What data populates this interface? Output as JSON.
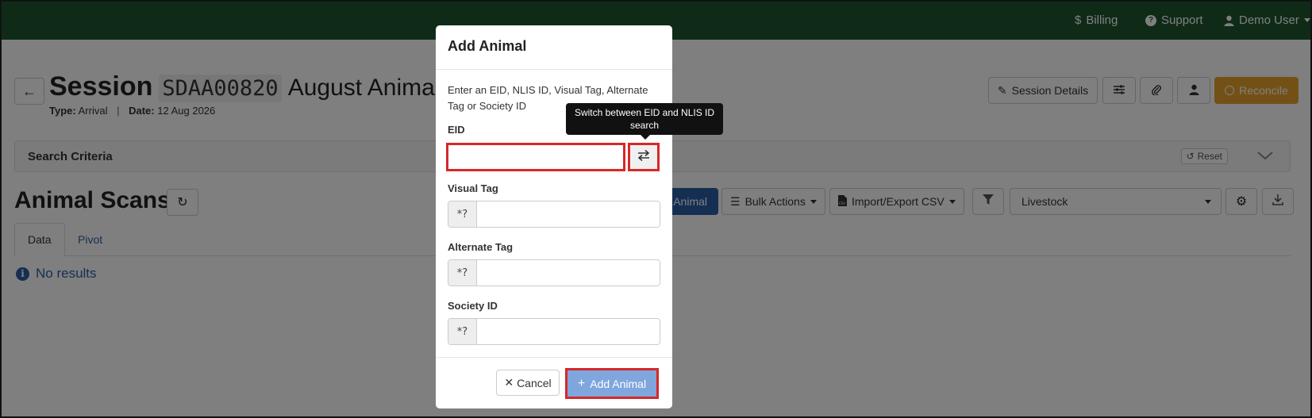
{
  "navbar": {
    "billing": "Billing",
    "support": "Support",
    "user": "Demo User",
    "color": "#1e5631"
  },
  "session": {
    "title": "Session",
    "code": "SDAA00820",
    "name": "August Animals",
    "type_label": "Type:",
    "type_value": "Arrival",
    "date_label": "Date:",
    "date_value": "12 Aug 2026"
  },
  "toolbar": {
    "session_details": "Session Details",
    "reconcile": "Reconcile",
    "reconcile_color": "#e6a22c"
  },
  "search_criteria": {
    "title": "Search Criteria",
    "reset": "Reset"
  },
  "scans": {
    "title": "Animal Scans",
    "add_animal": "Animal",
    "bulk_actions": "Bulk Actions",
    "import_export": "Import/Export CSV",
    "livestock": "Livestock",
    "tabs": [
      {
        "label": "Data",
        "active": true
      },
      {
        "label": "Pivot",
        "active": false
      }
    ],
    "no_results": "No results"
  },
  "modal": {
    "title": "Add Animal",
    "description": "Enter an EID, NLIS ID, Visual Tag, Alternate Tag or Society ID",
    "eid_label": "EID",
    "eid_value": "",
    "swap_tooltip": "Switch between EID and NLIS ID search",
    "visual_tag_label": "Visual Tag",
    "alternate_tag_label": "Alternate Tag",
    "society_id_label": "Society ID",
    "wildcard_addon": "*?",
    "cancel": "Cancel",
    "submit": "Add Animal"
  },
  "icons": {
    "billing": "dollar-icon",
    "support": "question-circle-icon",
    "user": "user-icon",
    "back": "arrow-left-icon",
    "swap": "exchange-arrows-icon"
  }
}
